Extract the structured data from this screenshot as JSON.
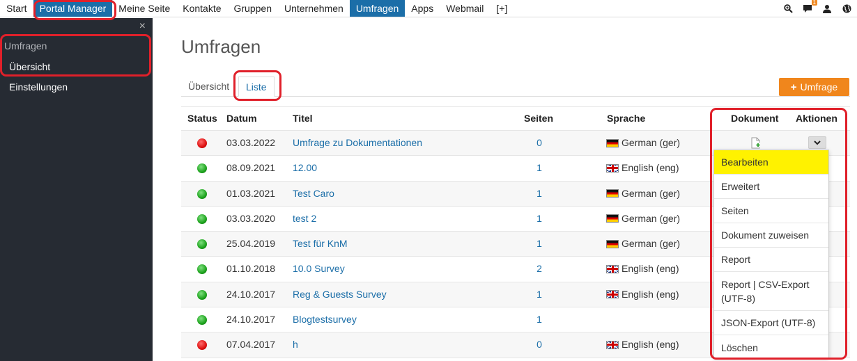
{
  "nav": {
    "items": [
      "Start",
      "Portal Manager",
      "Meine Seite",
      "Kontakte",
      "Gruppen",
      "Unternehmen",
      "Umfragen",
      "Apps",
      "Webmail",
      "[+]"
    ],
    "notification_count": "1"
  },
  "sidebar": {
    "close": "×",
    "section": "Umfragen",
    "items": [
      "Übersicht",
      "Einstellungen"
    ]
  },
  "page": {
    "title": "Umfragen",
    "tabs": [
      "Übersicht",
      "Liste"
    ],
    "add_button": "Umfrage"
  },
  "table": {
    "headers": [
      "Status",
      "Datum",
      "Titel",
      "Seiten",
      "Sprache",
      "Dokument",
      "Aktionen"
    ],
    "rows": [
      {
        "status": "red",
        "date": "03.03.2022",
        "title": "Umfrage zu Dokumentationen",
        "pages": "0",
        "lang": "German (ger)",
        "flag": "de"
      },
      {
        "status": "green",
        "date": "08.09.2021",
        "title": "12.00",
        "pages": "1",
        "lang": "English (eng)",
        "flag": "gb"
      },
      {
        "status": "green",
        "date": "01.03.2021",
        "title": "Test Caro",
        "pages": "1",
        "lang": "German (ger)",
        "flag": "de"
      },
      {
        "status": "green",
        "date": "03.03.2020",
        "title": "test 2",
        "pages": "1",
        "lang": "German (ger)",
        "flag": "de"
      },
      {
        "status": "green",
        "date": "25.04.2019",
        "title": "Test für KnM",
        "pages": "1",
        "lang": "German (ger)",
        "flag": "de"
      },
      {
        "status": "green",
        "date": "01.10.2018",
        "title": "10.0 Survey",
        "pages": "2",
        "lang": "English (eng)",
        "flag": "gb"
      },
      {
        "status": "green",
        "date": "24.10.2017",
        "title": "Reg & Guests Survey",
        "pages": "1",
        "lang": "English (eng)",
        "flag": "gb"
      },
      {
        "status": "green",
        "date": "24.10.2017",
        "title": "Blogtestsurvey",
        "pages": "1",
        "lang": "",
        "flag": ""
      },
      {
        "status": "red",
        "date": "07.04.2017",
        "title": "h",
        "pages": "0",
        "lang": "English (eng)",
        "flag": "gb"
      }
    ]
  },
  "actions_menu": {
    "items": [
      "Bearbeiten",
      "Erweitert",
      "Seiten",
      "Dokument zuweisen",
      "Report",
      "Report | CSV-Export (UTF-8)",
      "JSON-Export (UTF-8)",
      "Löschen"
    ],
    "highlighted_color": "#fff200"
  },
  "colors": {
    "accent": "#1b6ea8",
    "add_button": "#f0861c",
    "sidebar_bg": "#262b33",
    "annotation": "#e0202a"
  }
}
